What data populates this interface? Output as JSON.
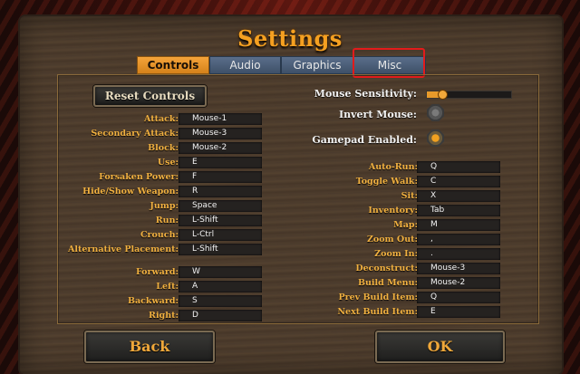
{
  "title": "Settings",
  "tabs": [
    {
      "label": "Controls",
      "active": true
    },
    {
      "label": "Audio",
      "active": false
    },
    {
      "label": "Graphics",
      "active": false
    },
    {
      "label": "Misc",
      "active": false
    }
  ],
  "reset_label": "Reset Controls",
  "left_bindings": [
    {
      "action": "Attack:",
      "key": "Mouse-1"
    },
    {
      "action": "Secondary Attack:",
      "key": "Mouse-3"
    },
    {
      "action": "Block:",
      "key": "Mouse-2"
    },
    {
      "action": "Use:",
      "key": "E"
    },
    {
      "action": "Forsaken Power:",
      "key": "F"
    },
    {
      "action": "Hide/Show Weapon:",
      "key": "R"
    },
    {
      "action": "Jump:",
      "key": "Space"
    },
    {
      "action": "Run:",
      "key": "L-Shift"
    },
    {
      "action": "Crouch:",
      "key": "L-Ctrl"
    },
    {
      "action": "Alternative Placement:",
      "key": "L-Shift"
    },
    {
      "action": "Forward:",
      "key": "W"
    },
    {
      "action": "Left:",
      "key": "A"
    },
    {
      "action": "Backward:",
      "key": "S"
    },
    {
      "action": "Right:",
      "key": "D"
    }
  ],
  "options": {
    "mouse_sensitivity_label": "Mouse Sensitivity:",
    "mouse_sensitivity_value": 0.18,
    "invert_mouse_label": "Invert Mouse:",
    "invert_mouse": false,
    "gamepad_label": "Gamepad Enabled:",
    "gamepad_enabled": true
  },
  "right_bindings": [
    {
      "action": "Auto-Run:",
      "key": "Q"
    },
    {
      "action": "Toggle Walk:",
      "key": "C"
    },
    {
      "action": "Sit:",
      "key": "X"
    },
    {
      "action": "Inventory:",
      "key": "Tab"
    },
    {
      "action": "Map:",
      "key": "M"
    },
    {
      "action": "Zoom Out:",
      "key": ","
    },
    {
      "action": "Zoom In:",
      "key": "."
    },
    {
      "action": "Deconstruct:",
      "key": "Mouse-3"
    },
    {
      "action": "Build Menu:",
      "key": "Mouse-2"
    },
    {
      "action": "Prev Build Item:",
      "key": "Q"
    },
    {
      "action": "Next Build Item:",
      "key": "E"
    }
  ],
  "back_label": "Back",
  "ok_label": "OK",
  "colors": {
    "accent": "#f5a021",
    "tab_active": "#e8962a",
    "tab_inactive": "#4a5e78",
    "highlight": "#e21b1b"
  }
}
